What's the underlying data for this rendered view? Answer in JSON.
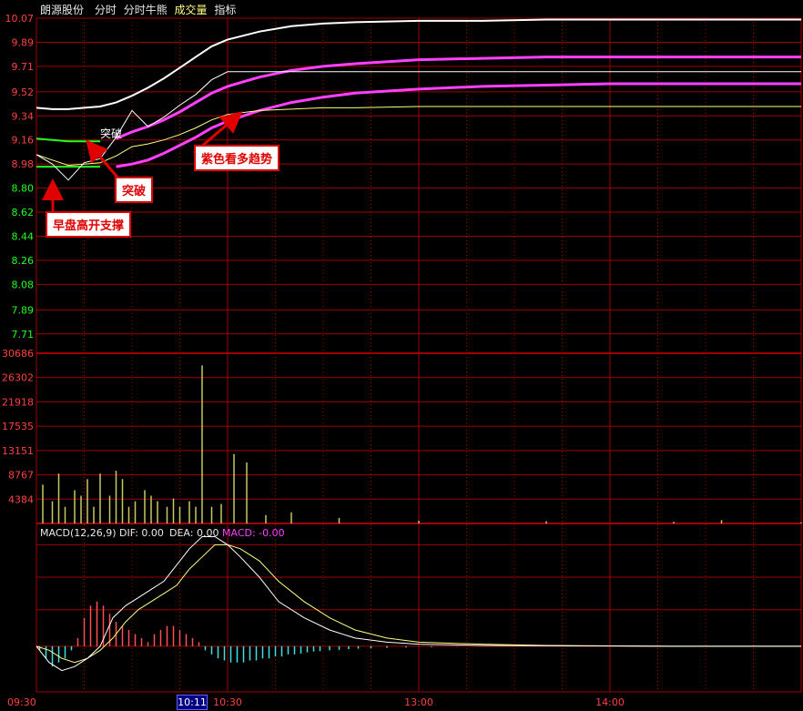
{
  "header": {
    "stock_name": "朗源股份",
    "tabs": [
      "分时",
      "分时牛熊",
      "成交量",
      "指标"
    ],
    "active_tab": "成交量"
  },
  "colors": {
    "grid": "#a00000",
    "price_line": "#ffffff",
    "avg_line": "#ffff80",
    "magenta": "#ff40ff",
    "green": "#20ff20",
    "axis_up": "#ff4040",
    "axis_down": "#20ff20",
    "volume": "#c8c864",
    "macd_pos": "#ff5050",
    "macd_neg": "#40e0e0",
    "dif": "#ffffff",
    "dea": "#ffff80"
  },
  "callouts": {
    "early_support": "早盘高开支撑",
    "breakout": "突破",
    "purple_bullish": "紫色看多趋势",
    "chart_breakout_label": "突破"
  },
  "macd_legend": {
    "name": "MACD(12,26,9)",
    "dif_label": "DIF: 0.00",
    "dea_label": "DEA: 0.00",
    "macd_label": "MACD: -0.00"
  },
  "time_axis": {
    "labels": [
      "09:30",
      "10:30",
      "13:00",
      "14:00"
    ],
    "cursor_time": "10:11"
  },
  "chart_data": [
    {
      "type": "line",
      "panel": "price",
      "y_ticks": [
        "10.07",
        "9.89",
        "9.71",
        "9.52",
        "9.34",
        "9.16",
        "8.98",
        "8.80",
        "8.62",
        "8.44",
        "8.26",
        "8.08",
        "7.89",
        "7.71"
      ],
      "ylim": [
        7.62,
        10.07
      ],
      "x": [
        0,
        5,
        10,
        15,
        20,
        25,
        30,
        35,
        40,
        45,
        50,
        55,
        60,
        70,
        80,
        90,
        100,
        120,
        140,
        160,
        180,
        200,
        240
      ],
      "series": [
        {
          "key": "price",
          "values": [
            9.05,
            8.98,
            8.86,
            8.99,
            9.02,
            9.18,
            9.38,
            9.26,
            9.33,
            9.42,
            9.5,
            9.61,
            9.67,
            9.67,
            9.67,
            9.67,
            9.67,
            9.67,
            9.67,
            9.67,
            9.67,
            9.67,
            9.67
          ]
        },
        {
          "key": "avg",
          "values": [
            9.05,
            9.01,
            8.97,
            8.98,
            8.99,
            9.04,
            9.11,
            9.13,
            9.16,
            9.2,
            9.25,
            9.31,
            9.35,
            9.38,
            9.39,
            9.4,
            9.4,
            9.41,
            9.41,
            9.41,
            9.41,
            9.41,
            9.41
          ]
        },
        {
          "key": "white_upper",
          "values": [
            9.4,
            9.39,
            9.39,
            9.4,
            9.41,
            9.44,
            9.49,
            9.55,
            9.62,
            9.7,
            9.78,
            9.86,
            9.91,
            9.97,
            10.01,
            10.03,
            10.04,
            10.05,
            10.05,
            10.06,
            10.06,
            10.06,
            10.06
          ]
        },
        {
          "key": "magenta_upper",
          "values": [
            null,
            null,
            null,
            null,
            null,
            9.17,
            9.22,
            9.26,
            9.31,
            9.37,
            9.44,
            9.51,
            9.56,
            9.63,
            9.68,
            9.71,
            9.73,
            9.76,
            9.77,
            9.78,
            9.78,
            9.78,
            9.78
          ]
        },
        {
          "key": "magenta_lower",
          "values": [
            null,
            null,
            null,
            null,
            null,
            8.96,
            8.98,
            9.01,
            9.06,
            9.12,
            9.18,
            9.25,
            9.3,
            9.38,
            9.44,
            9.48,
            9.51,
            9.54,
            9.56,
            9.57,
            9.58,
            9.58,
            9.58
          ]
        },
        {
          "key": "green_upper",
          "values": [
            9.17,
            9.16,
            9.15,
            9.15,
            9.15
          ]
        },
        {
          "key": "green_lower",
          "values": [
            8.96,
            8.96,
            8.96,
            8.96,
            8.96
          ]
        }
      ]
    },
    {
      "type": "bar",
      "panel": "volume",
      "y_ticks": [
        "30686",
        "26302",
        "21918",
        "17535",
        "13151",
        "8767",
        "4384"
      ],
      "ylim": [
        0,
        32000
      ],
      "x": [
        2,
        5,
        7,
        9,
        12,
        14,
        16,
        18,
        20,
        23,
        25,
        27,
        29,
        31,
        34,
        36,
        38,
        41,
        43,
        45,
        48,
        50,
        52,
        55,
        58,
        62,
        66,
        72,
        80,
        95,
        120,
        160,
        200,
        215,
        240
      ],
      "values": [
        7000,
        4000,
        9000,
        3000,
        6000,
        5000,
        8000,
        3000,
        9000,
        5000,
        9500,
        8000,
        3000,
        4000,
        6000,
        5000,
        4000,
        3000,
        4500,
        3000,
        4000,
        3000,
        28500,
        3000,
        3500,
        12500,
        11000,
        1500,
        2000,
        1000,
        500,
        400,
        300,
        600,
        200
      ]
    },
    {
      "type": "line",
      "panel": "macd",
      "legend": [
        "MACD(12,26,9)",
        "DIF: 0.00",
        "DEA: 0.00",
        "MACD: -0.00"
      ],
      "ylim": [
        -0.09,
        0.28
      ],
      "x": [
        0,
        4,
        8,
        12,
        16,
        20,
        24,
        28,
        32,
        36,
        40,
        44,
        48,
        52,
        56,
        60,
        64,
        70,
        76,
        84,
        92,
        100,
        110,
        120,
        140,
        160,
        200,
        240
      ],
      "series": [
        {
          "key": "dif",
          "values": [
            0.0,
            -0.04,
            -0.06,
            -0.05,
            -0.03,
            0.0,
            0.07,
            0.1,
            0.12,
            0.14,
            0.16,
            0.2,
            0.24,
            0.27,
            0.27,
            0.25,
            0.22,
            0.17,
            0.11,
            0.07,
            0.04,
            0.02,
            0.01,
            0.005,
            0.002,
            0.001,
            0.0,
            0.0
          ]
        },
        {
          "key": "dea",
          "values": [
            0.0,
            -0.01,
            -0.03,
            -0.04,
            -0.03,
            -0.01,
            0.02,
            0.06,
            0.09,
            0.11,
            0.13,
            0.15,
            0.19,
            0.22,
            0.25,
            0.25,
            0.24,
            0.21,
            0.16,
            0.11,
            0.07,
            0.04,
            0.02,
            0.01,
            0.005,
            0.002,
            0.0,
            0.0
          ]
        }
      ],
      "histogram": {
        "x": [
          1,
          3,
          5,
          7,
          9,
          11,
          13,
          15,
          17,
          19,
          21,
          23,
          25,
          27,
          29,
          31,
          33,
          35,
          37,
          39,
          41,
          43,
          45,
          47,
          49,
          51,
          53,
          55,
          57,
          59,
          61,
          63,
          65,
          67,
          69,
          71,
          73,
          75,
          77,
          79,
          81,
          83,
          85,
          87,
          89,
          92,
          95,
          98,
          101,
          105,
          110,
          116,
          124,
          132
        ],
        "values": [
          -0.01,
          -0.03,
          -0.05,
          -0.04,
          -0.03,
          -0.01,
          0.02,
          0.07,
          0.1,
          0.11,
          0.1,
          0.08,
          0.06,
          0.05,
          0.04,
          0.03,
          0.02,
          0.01,
          0.03,
          0.04,
          0.05,
          0.05,
          0.04,
          0.03,
          0.02,
          0.01,
          -0.01,
          -0.02,
          -0.03,
          -0.035,
          -0.04,
          -0.04,
          -0.04,
          -0.035,
          -0.035,
          -0.03,
          -0.03,
          -0.025,
          -0.025,
          -0.02,
          -0.02,
          -0.018,
          -0.015,
          -0.013,
          -0.012,
          -0.01,
          -0.009,
          -0.007,
          -0.006,
          -0.005,
          -0.004,
          -0.003,
          -0.002,
          -0.001
        ]
      }
    }
  ]
}
